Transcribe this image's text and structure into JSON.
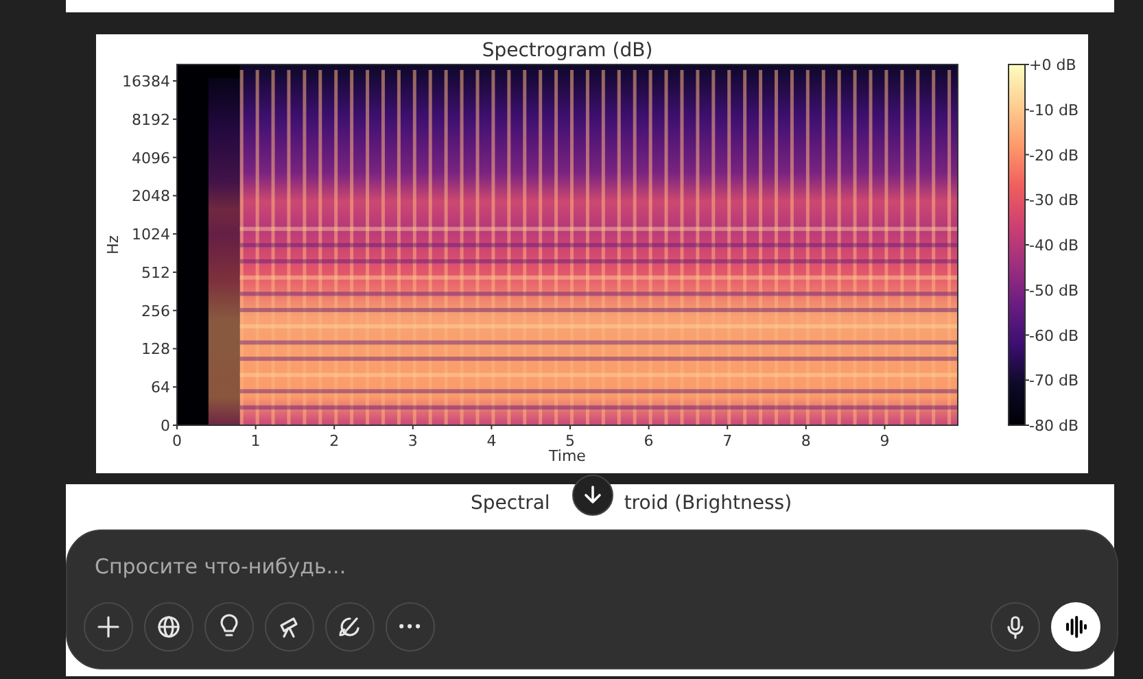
{
  "spectrogram": {
    "title": "Spectrogram (dB)",
    "ylabel": "Hz",
    "xlabel": "Time",
    "xticks": [
      "0",
      "1",
      "2",
      "3",
      "4",
      "5",
      "6",
      "7",
      "8",
      "9"
    ],
    "yticks": [
      "16384",
      "8192",
      "4096",
      "2048",
      "1024",
      "512",
      "256",
      "128",
      "64",
      "0"
    ],
    "colorbar_ticks": [
      "+0 dB",
      "-10 dB",
      "-20 dB",
      "-30 dB",
      "-40 dB",
      "-50 dB",
      "-60 dB",
      "-70 dB",
      "-80 dB"
    ]
  },
  "next_panel": {
    "title_parts": [
      "Spectral",
      "troid (Brightness)"
    ]
  },
  "composer": {
    "placeholder": "Спросите что-нибудь..."
  }
}
